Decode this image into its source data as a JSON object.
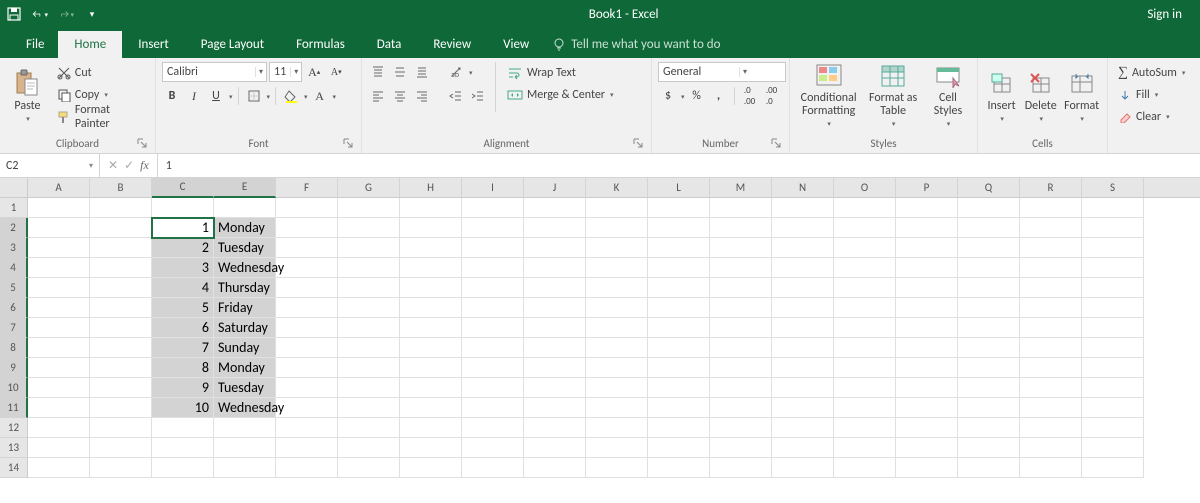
{
  "title": "Book1  -  Excel",
  "signin": "Sign in",
  "qat": {
    "save": "save",
    "undo": "undo",
    "redo": "redo"
  },
  "tabs": [
    "File",
    "Home",
    "Insert",
    "Page Layout",
    "Formulas",
    "Data",
    "Review",
    "View"
  ],
  "active_tab": "Home",
  "tellme": "Tell me what you want to do",
  "ribbon": {
    "clipboard": {
      "label": "Clipboard",
      "paste": "Paste",
      "cut": "Cut",
      "copy": "Copy",
      "fp": "Format Painter"
    },
    "font": {
      "label": "Font",
      "name": "Calibri",
      "size": "11",
      "bold": "B",
      "italic": "I",
      "underline": "U"
    },
    "alignment": {
      "label": "Alignment",
      "wrap": "Wrap Text",
      "merge": "Merge & Center"
    },
    "number": {
      "label": "Number",
      "format": "General"
    },
    "styles": {
      "label": "Styles",
      "cond": "Conditional Formatting",
      "table": "Format as Table",
      "cellst": "Cell Styles"
    },
    "cells": {
      "label": "Cells",
      "insert": "Insert",
      "delete": "Delete",
      "format": "Format"
    },
    "editing": {
      "label": "",
      "autosum": "AutoSum",
      "fill": "Fill",
      "clear": "Clear"
    }
  },
  "namebox": "C2",
  "formula": "1",
  "columns": [
    "A",
    "B",
    "C",
    "E",
    "F",
    "G",
    "H",
    "I",
    "J",
    "K",
    "L",
    "M",
    "N",
    "O",
    "P",
    "Q",
    "R",
    "S"
  ],
  "row_count": 14,
  "selection": {
    "active": "C2",
    "range_cols": [
      "C",
      "E"
    ],
    "range_rows": [
      2,
      11
    ]
  },
  "cells": {
    "C2": {
      "v": "1",
      "t": "n"
    },
    "E2": {
      "v": "Monday",
      "t": "s"
    },
    "C3": {
      "v": "2",
      "t": "n"
    },
    "E3": {
      "v": "Tuesday",
      "t": "s"
    },
    "C4": {
      "v": "3",
      "t": "n"
    },
    "E4": {
      "v": "Wednesday",
      "t": "s"
    },
    "C5": {
      "v": "4",
      "t": "n"
    },
    "E5": {
      "v": "Thursday",
      "t": "s"
    },
    "C6": {
      "v": "5",
      "t": "n"
    },
    "E6": {
      "v": "Friday",
      "t": "s"
    },
    "C7": {
      "v": "6",
      "t": "n"
    },
    "E7": {
      "v": "Saturday",
      "t": "s"
    },
    "C8": {
      "v": "7",
      "t": "n"
    },
    "E8": {
      "v": "Sunday",
      "t": "s"
    },
    "C9": {
      "v": "8",
      "t": "n"
    },
    "E9": {
      "v": "Monday",
      "t": "s"
    },
    "C10": {
      "v": "9",
      "t": "n"
    },
    "E10": {
      "v": "Tuesday",
      "t": "s"
    },
    "C11": {
      "v": "10",
      "t": "n"
    },
    "E11": {
      "v": "Wednesday",
      "t": "s"
    }
  },
  "colors": {
    "brand": "#217346",
    "title_bg": "#0e6837"
  }
}
